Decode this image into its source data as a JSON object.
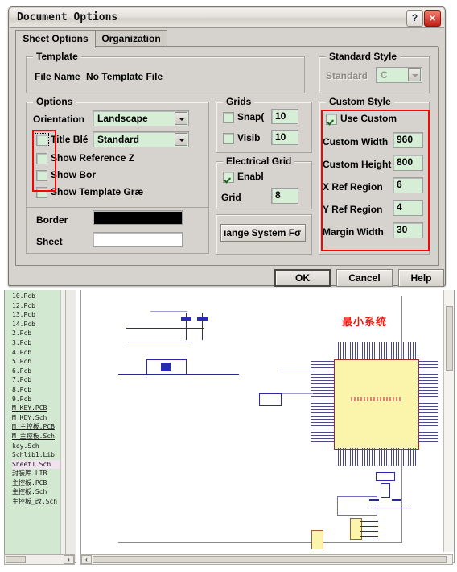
{
  "dialog": {
    "title": "Document Options",
    "help_button": "?",
    "close_button": "×",
    "tabs": [
      {
        "label": "Sheet Options",
        "active": true
      },
      {
        "label": "Organization",
        "active": false
      }
    ],
    "template_group": {
      "legend": "Template",
      "file_name_label": "File Name",
      "file_name_value": "No Template File"
    },
    "options_group": {
      "legend": "Options",
      "orientation_label": "Orientation",
      "orientation_value": "Landscape",
      "title_block_label": "Title Blé",
      "title_block_value": "Standard",
      "show_reference_label": "Show Reference Z",
      "show_border_label": "Show Bor",
      "show_template_label": "Show Template Græ",
      "border_label": "Border",
      "border_color": "#000000",
      "sheet_label": "Sheet",
      "sheet_color": "#ffffff"
    },
    "grids_group": {
      "legend": "Grids",
      "snap_label": "Snap(",
      "snap_value": "10",
      "visible_label": "Visib",
      "visible_value": "10"
    },
    "electrical_grid_group": {
      "legend": "Electrical Grid",
      "enable_label": "Enabl",
      "grid_label": "Grid",
      "grid_value": "8"
    },
    "system_font_button": "ıange System Fσ",
    "standard_style_group": {
      "legend": "Standard Style",
      "standard_label": "Standard",
      "standard_value": "C"
    },
    "custom_style_group": {
      "legend": "Custom Style",
      "use_custom_label": "Use Custom",
      "custom_width_label": "Custom Width",
      "custom_width_value": "960",
      "custom_height_label": "Custom Height",
      "custom_height_value": "800",
      "x_ref_label": "X Ref Region",
      "x_ref_value": "6",
      "y_ref_label": "Y Ref Region",
      "y_ref_value": "4",
      "margin_width_label": "Margin Width",
      "margin_width_value": "30"
    },
    "buttons": {
      "ok": "OK",
      "cancel": "Cancel",
      "help": "Help"
    },
    "highlight_color": "#ff0000"
  },
  "app": {
    "file_list": [
      {
        "name": "10.Pcb",
        "underline": false,
        "selected": false
      },
      {
        "name": "12.Pcb",
        "underline": false,
        "selected": false
      },
      {
        "name": "13.Pcb",
        "underline": false,
        "selected": false
      },
      {
        "name": "14.Pcb",
        "underline": false,
        "selected": false
      },
      {
        "name": "2.Pcb",
        "underline": false,
        "selected": false
      },
      {
        "name": "3.Pcb",
        "underline": false,
        "selected": false
      },
      {
        "name": "4.Pcb",
        "underline": false,
        "selected": false
      },
      {
        "name": "5.Pcb",
        "underline": false,
        "selected": false
      },
      {
        "name": "6.Pcb",
        "underline": false,
        "selected": false
      },
      {
        "name": "7.Pcb",
        "underline": false,
        "selected": false
      },
      {
        "name": "8.Pcb",
        "underline": false,
        "selected": false
      },
      {
        "name": "9.Pcb",
        "underline": false,
        "selected": false
      },
      {
        "name": "M_KEY.PCB",
        "underline": true,
        "selected": false
      },
      {
        "name": "M_KEY.Sch",
        "underline": true,
        "selected": false
      },
      {
        "name": "M_主控板.PCB",
        "underline": true,
        "selected": false
      },
      {
        "name": "M_主控板.Sch",
        "underline": true,
        "selected": false
      },
      {
        "name": "key.Sch",
        "underline": false,
        "selected": false
      },
      {
        "name": "Schlib1.Lib",
        "underline": false,
        "selected": false
      },
      {
        "name": "Sheet1.Sch",
        "underline": false,
        "selected": true
      },
      {
        "name": "封装库.LIB",
        "underline": false,
        "selected": false
      },
      {
        "name": "主控板.PCB",
        "underline": false,
        "selected": false
      },
      {
        "name": "主控板.Sch",
        "underline": false,
        "selected": false
      },
      {
        "name": "主控板_改.Sch",
        "underline": false,
        "selected": false
      }
    ],
    "schematic": {
      "annotation_title": "最小系统",
      "chip_color": "#fbf5ac",
      "wire_color": "#2a2a8c"
    },
    "scroll_left_arrow": "‹",
    "scroll_right_arrow": "›"
  }
}
